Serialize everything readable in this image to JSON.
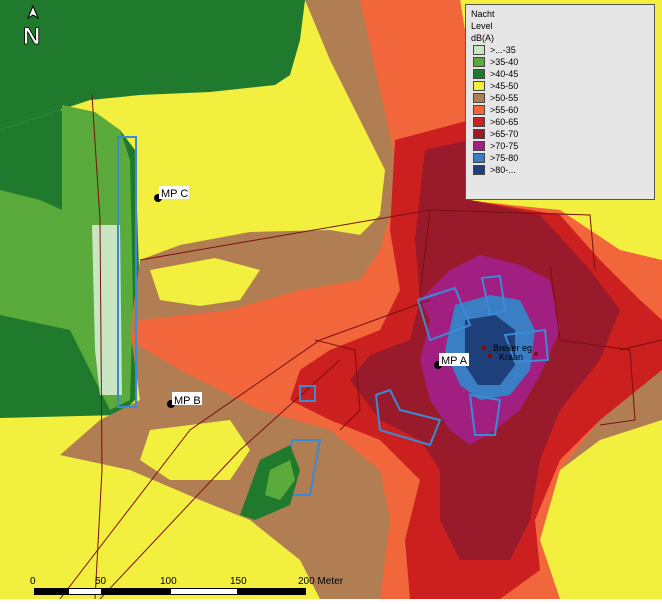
{
  "legend": {
    "title_lines": [
      "Nacht",
      "Level",
      "dB(A)"
    ],
    "items": [
      {
        "label": ">...-35",
        "color": "#c9e6c2"
      },
      {
        "label": ">35-40",
        "color": "#5aaa3c"
      },
      {
        "label": ">40-45",
        "color": "#1f7a2e"
      },
      {
        "label": ">45-50",
        "color": "#f2ef3e"
      },
      {
        "label": ">50-55",
        "color": "#b07e52"
      },
      {
        "label": ">55-60",
        "color": "#f2663c"
      },
      {
        "label": ">60-65",
        "color": "#cc1f1f"
      },
      {
        "label": ">65-70",
        "color": "#991a2a"
      },
      {
        "label": ">70-75",
        "color": "#a01f80"
      },
      {
        "label": ">75-80",
        "color": "#3a7fc4"
      },
      {
        "label": ">80-...",
        "color": "#1e3f7a"
      }
    ]
  },
  "north_label": "N",
  "measurement_points": [
    {
      "label": "MP C"
    },
    {
      "label": "MP B"
    },
    {
      "label": "MP A"
    }
  ],
  "sources": [
    {
      "label": "Breker eg"
    },
    {
      "label": "Kraan"
    }
  ],
  "scale_bar": {
    "ticks": [
      "0",
      "50",
      "100",
      "150",
      "200 Meter"
    ]
  }
}
